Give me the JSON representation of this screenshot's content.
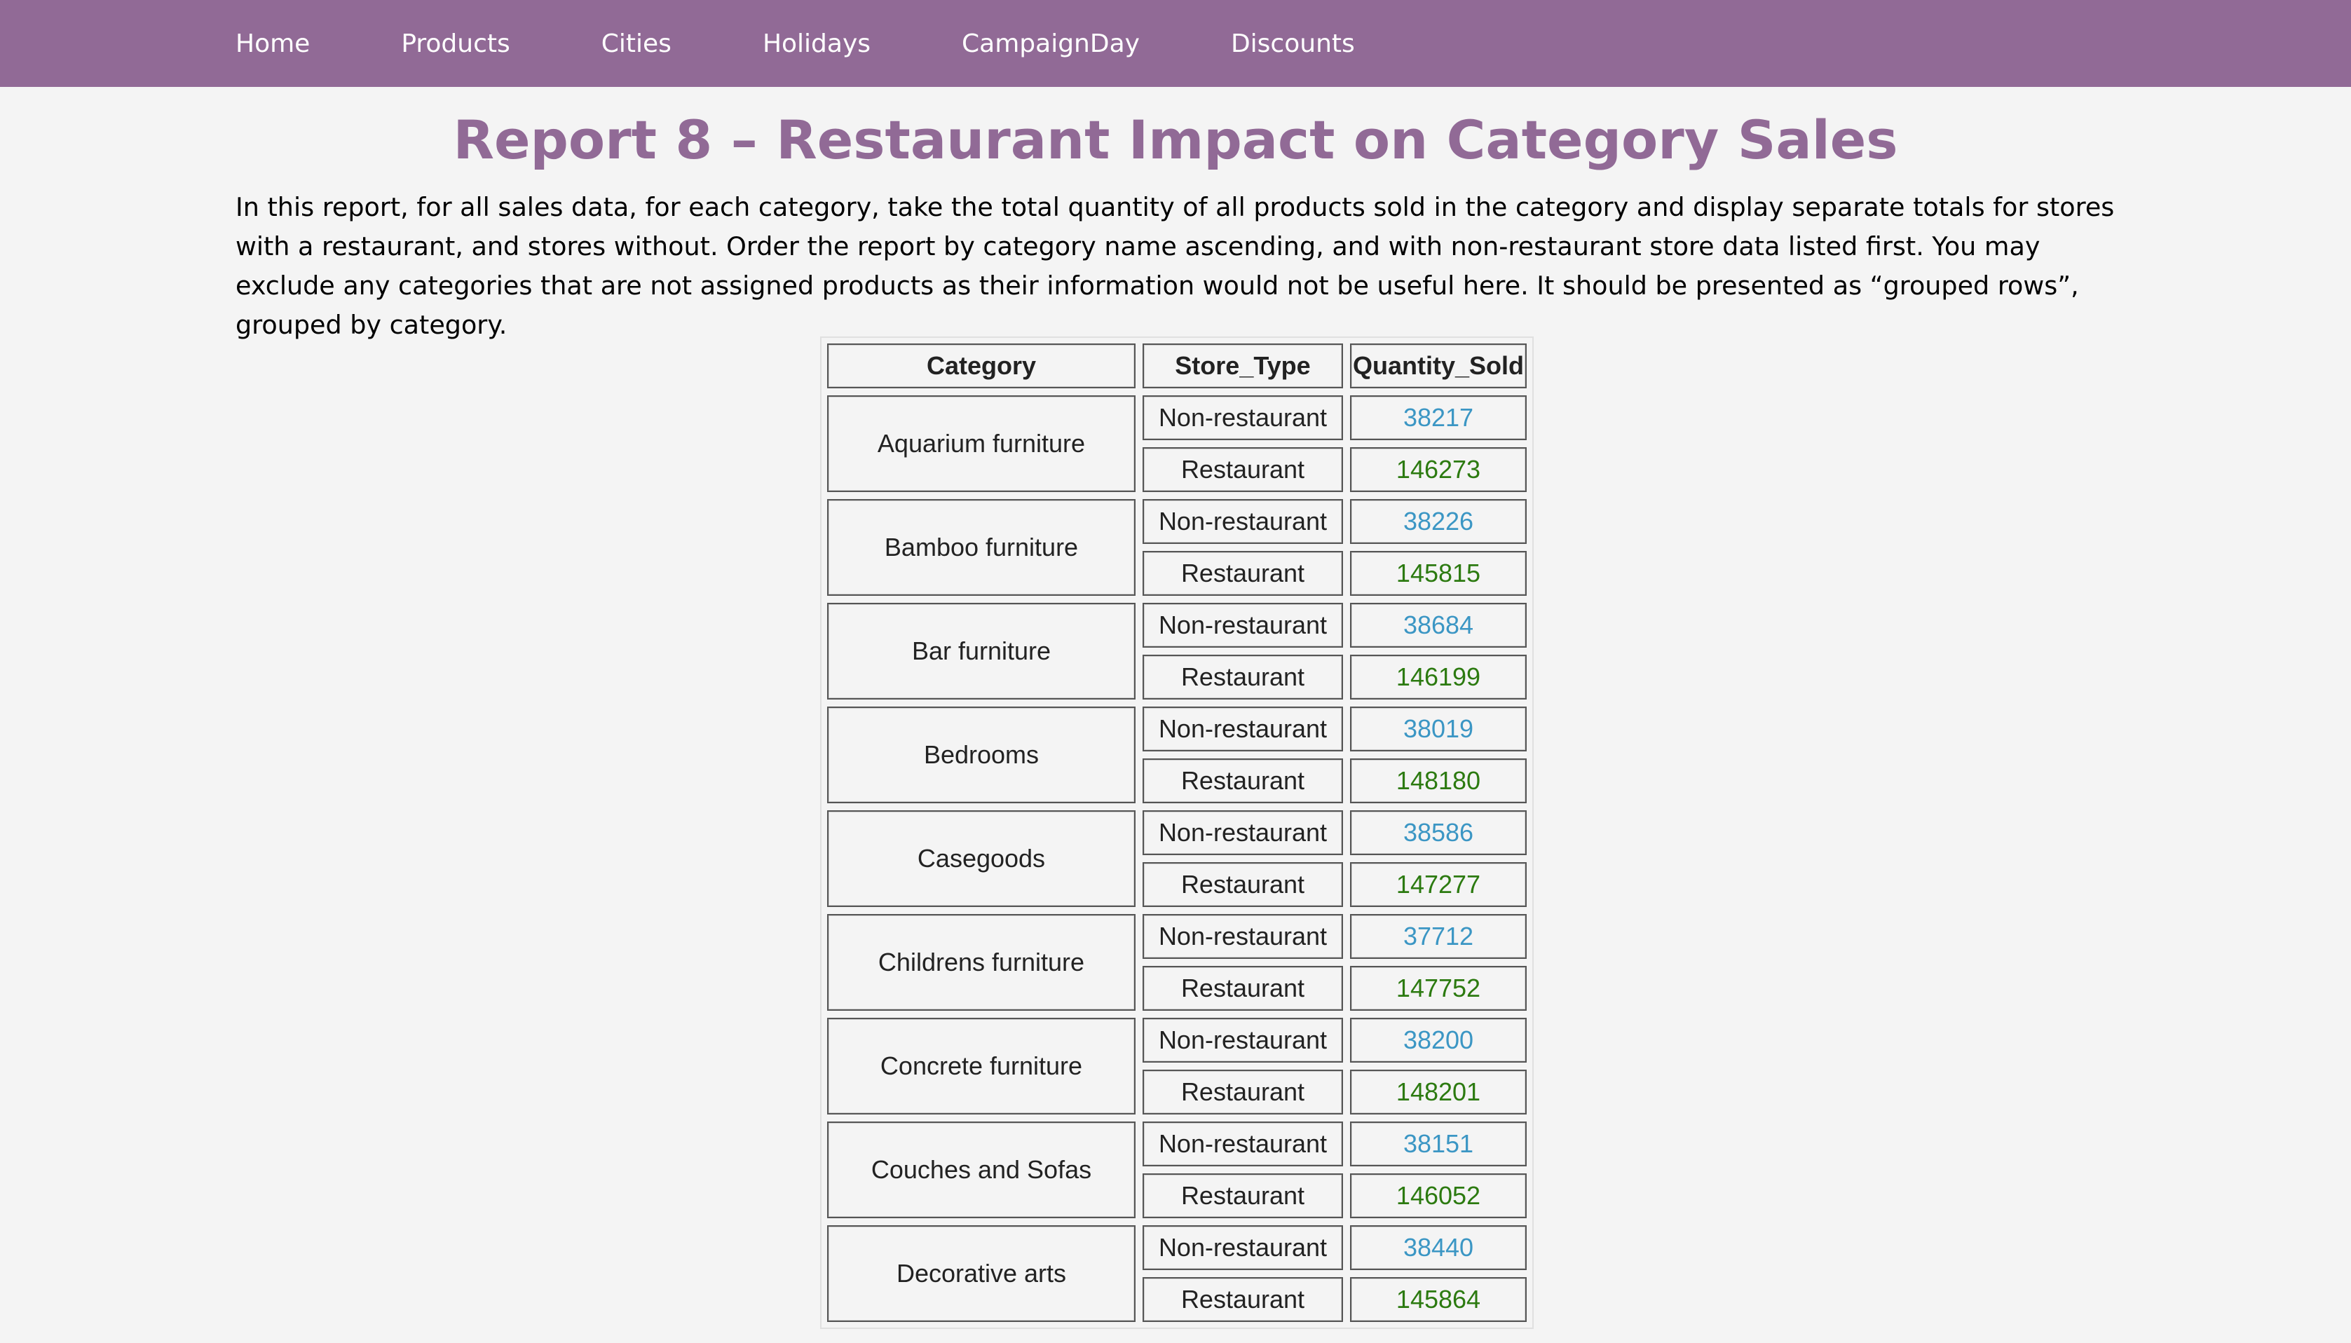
{
  "nav": {
    "items": [
      "Home",
      "Products",
      "Cities",
      "Holidays",
      "CampaignDay",
      "Discounts"
    ]
  },
  "report": {
    "title": "Report 8 – Restaurant Impact on Category Sales",
    "description": "In this report, for all sales data, for each category, take the total quantity of all products sold in the category and display separate totals for stores with a restaurant, and stores without. Order the report by category name ascending, and with non-restaurant store data listed first. You may exclude any categories that are not assigned products as their information would not be useful here. It should be presented as “grouped rows”, grouped by category."
  },
  "table": {
    "headers": [
      "Category",
      "Store_Type",
      "Quantity_Sold"
    ],
    "groups": [
      {
        "category": "Aquarium furniture",
        "rows": [
          {
            "store_type": "Non-restaurant",
            "quantity": "38217"
          },
          {
            "store_type": "Restaurant",
            "quantity": "146273"
          }
        ]
      },
      {
        "category": "Bamboo furniture",
        "rows": [
          {
            "store_type": "Non-restaurant",
            "quantity": "38226"
          },
          {
            "store_type": "Restaurant",
            "quantity": "145815"
          }
        ]
      },
      {
        "category": "Bar furniture",
        "rows": [
          {
            "store_type": "Non-restaurant",
            "quantity": "38684"
          },
          {
            "store_type": "Restaurant",
            "quantity": "146199"
          }
        ]
      },
      {
        "category": "Bedrooms",
        "rows": [
          {
            "store_type": "Non-restaurant",
            "quantity": "38019"
          },
          {
            "store_type": "Restaurant",
            "quantity": "148180"
          }
        ]
      },
      {
        "category": "Casegoods",
        "rows": [
          {
            "store_type": "Non-restaurant",
            "quantity": "38586"
          },
          {
            "store_type": "Restaurant",
            "quantity": "147277"
          }
        ]
      },
      {
        "category": "Childrens furniture",
        "rows": [
          {
            "store_type": "Non-restaurant",
            "quantity": "37712"
          },
          {
            "store_type": "Restaurant",
            "quantity": "147752"
          }
        ]
      },
      {
        "category": "Concrete furniture",
        "rows": [
          {
            "store_type": "Non-restaurant",
            "quantity": "38200"
          },
          {
            "store_type": "Restaurant",
            "quantity": "148201"
          }
        ]
      },
      {
        "category": "Couches and Sofas",
        "rows": [
          {
            "store_type": "Non-restaurant",
            "quantity": "38151"
          },
          {
            "store_type": "Restaurant",
            "quantity": "146052"
          }
        ]
      },
      {
        "category": "Decorative arts",
        "rows": [
          {
            "store_type": "Non-restaurant",
            "quantity": "38440"
          },
          {
            "store_type": "Restaurant",
            "quantity": "145864"
          }
        ]
      }
    ]
  },
  "colors": {
    "nav_background": "#916a96",
    "title": "#916a96",
    "non_restaurant_value": "#3b96c4",
    "restaurant_value": "#2c7a10"
  }
}
